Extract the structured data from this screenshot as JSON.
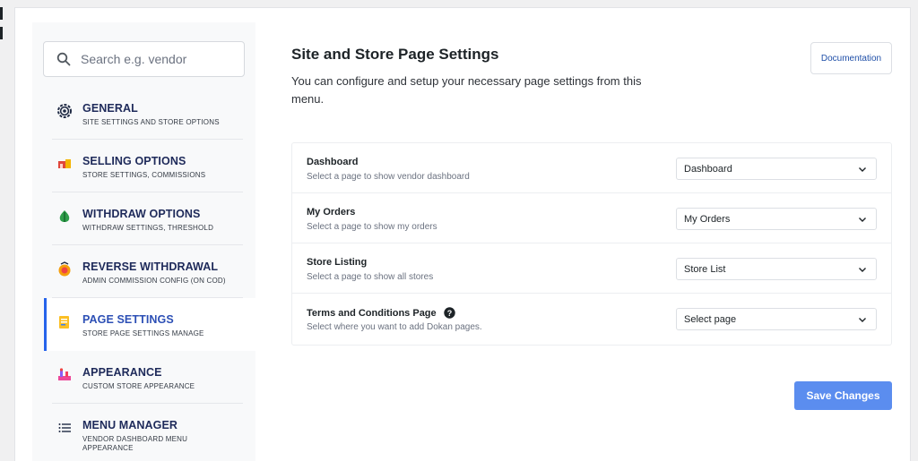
{
  "search": {
    "placeholder": "Search e.g. vendor"
  },
  "sidebar": {
    "items": [
      {
        "title": "GENERAL",
        "subtitle": "SITE SETTINGS AND STORE OPTIONS",
        "icon": "gear-icon"
      },
      {
        "title": "SELLING OPTIONS",
        "subtitle": "STORE SETTINGS, COMMISSIONS",
        "icon": "store-icon"
      },
      {
        "title": "WITHDRAW OPTIONS",
        "subtitle": "WITHDRAW SETTINGS, THRESHOLD",
        "icon": "money-bag-icon"
      },
      {
        "title": "REVERSE WITHDRAWAL",
        "subtitle": "ADMIN COMMISSION CONFIG (ON COD)",
        "icon": "coin-icon"
      },
      {
        "title": "PAGE SETTINGS",
        "subtitle": "STORE PAGE SETTINGS MANAGE",
        "icon": "page-icon",
        "active": true
      },
      {
        "title": "APPEARANCE",
        "subtitle": "CUSTOM STORE APPEARANCE",
        "icon": "appearance-icon"
      },
      {
        "title": "MENU MANAGER",
        "subtitle": "VENDOR DASHBOARD MENU APPEARANCE",
        "icon": "list-icon"
      }
    ]
  },
  "main": {
    "title": "Site and Store Page Settings",
    "description": "You can configure and setup your necessary page settings from this menu.",
    "documentation_label": "Documentation",
    "settings": [
      {
        "label": "Dashboard",
        "description": "Select a page to show vendor dashboard",
        "value": "Dashboard"
      },
      {
        "label": "My Orders",
        "description": "Select a page to show my orders",
        "value": "My Orders"
      },
      {
        "label": "Store Listing",
        "description": "Select a page to show all stores",
        "value": "Store List"
      },
      {
        "label": "Terms and Conditions Page",
        "description": "Select where you want to add Dokan pages.",
        "value": "Select page",
        "has_help": true
      }
    ],
    "save_label": "Save Changes"
  },
  "colors": {
    "accent": "#2563eb",
    "save_button": "#5b8def",
    "menu_title": "#1e2a5a"
  }
}
